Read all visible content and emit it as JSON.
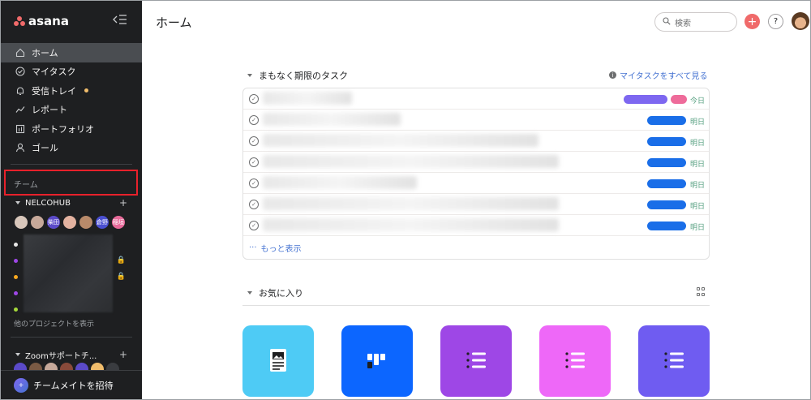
{
  "sidebar": {
    "logo_text": "asana",
    "nav": [
      {
        "label": "ホーム",
        "icon": "home-icon",
        "active": true
      },
      {
        "label": "マイタスク",
        "icon": "check-circle-icon"
      },
      {
        "label": "受信トレイ",
        "icon": "bell-icon",
        "badge": true
      },
      {
        "label": "レポート",
        "icon": "chart-line-icon"
      },
      {
        "label": "ポートフォリオ",
        "icon": "portfolio-icon"
      },
      {
        "label": "ゴール",
        "icon": "person-icon"
      }
    ],
    "team_label": "チーム",
    "team_group": "NELCOHUB",
    "team_avatars": [
      "",
      "",
      "柴田",
      "",
      "",
      "倉野",
      "稲垣"
    ],
    "other_projects": "他のプロジェクトを表示",
    "group2": "Zoomサポートチ...",
    "invite_label": "チームメイトを招待"
  },
  "header": {
    "title": "ホーム",
    "search_placeholder": "検索",
    "add_label": "+",
    "help_label": "?"
  },
  "tasks": {
    "heading": "まもなく期限のタスク",
    "see_all": "マイタスクをすべて見る",
    "rows": [
      {
        "due": "今日"
      },
      {
        "due": "明日"
      },
      {
        "due": "明日"
      },
      {
        "due": "明日"
      },
      {
        "due": "明日"
      },
      {
        "due": "明日"
      },
      {
        "due": "明日"
      }
    ],
    "more": "もっと表示"
  },
  "favorites": {
    "heading": "お気に入り",
    "tiles": [
      {
        "color": "#4ecbf5",
        "icon": "document-icon"
      },
      {
        "color": "#0c66ff",
        "icon": "board-icon"
      },
      {
        "color": "#9e47e6",
        "icon": "list-icon"
      },
      {
        "color": "#ee68f8",
        "icon": "list-icon"
      },
      {
        "color": "#6f5cf1",
        "icon": "list-icon"
      }
    ]
  },
  "colors": {
    "sidebar_bg": "#1e1f21",
    "accent": "#f06a6a",
    "link": "#4573d2",
    "due_green": "#58a182",
    "highlight_box": "#e8212b"
  }
}
